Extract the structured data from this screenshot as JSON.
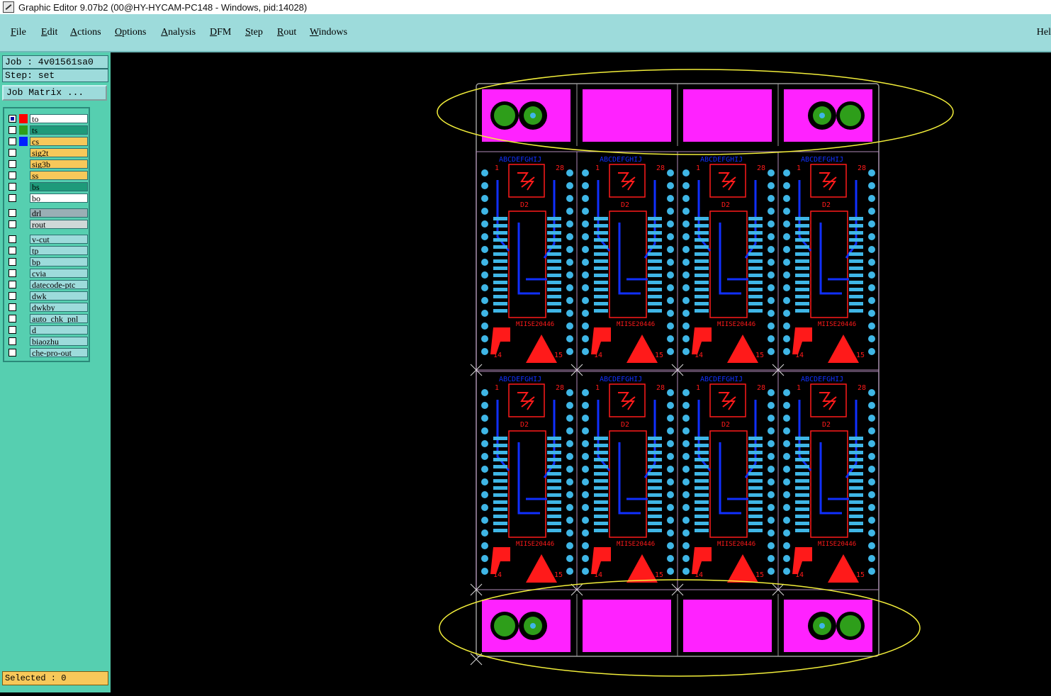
{
  "window": {
    "title": "Graphic Editor 9.07b2 (00@HY-HYCAM-PC148 - Windows, pid:14028)"
  },
  "menu": {
    "items": [
      "File",
      "Edit",
      "Actions",
      "Options",
      "Analysis",
      "DFM",
      "Step",
      "Rout",
      "Windows"
    ],
    "help": "Hel"
  },
  "job": {
    "label": "Job : 4v01561sa0",
    "step": "Step: set",
    "matrix_button": "Job Matrix ..."
  },
  "layers": [
    {
      "name": "to",
      "color": "#ff0000",
      "bg": "#ffffff",
      "selected": true
    },
    {
      "name": "ts",
      "color": "#2e9e1a",
      "bg": "#1e9a7a",
      "selected": false
    },
    {
      "name": "cs",
      "color": "#0020ff",
      "bg": "#f7c85a",
      "selected": false
    },
    {
      "name": "sig2t",
      "color": "",
      "bg": "#f7c85a",
      "selected": false
    },
    {
      "name": "sig3b",
      "color": "",
      "bg": "#f7c85a",
      "selected": false
    },
    {
      "name": "ss",
      "color": "",
      "bg": "#f7c85a",
      "selected": false
    },
    {
      "name": "bs",
      "color": "",
      "bg": "#1e9a7a",
      "selected": false
    },
    {
      "name": "bo",
      "color": "",
      "bg": "#ffffff",
      "selected": false
    },
    {
      "name": "drl",
      "color": "",
      "bg": "#9aafb5",
      "selected": false
    },
    {
      "name": "rout",
      "color": "",
      "bg": "#cfd8d8",
      "selected": false
    },
    {
      "name": "v-cut",
      "color": "",
      "bg": "#9ddbdb",
      "selected": false
    },
    {
      "name": "tp",
      "color": "",
      "bg": "#9ddbdb",
      "selected": false
    },
    {
      "name": "bp",
      "color": "",
      "bg": "#9ddbdb",
      "selected": false
    },
    {
      "name": "cvia",
      "color": "",
      "bg": "#9ddbdb",
      "selected": false
    },
    {
      "name": "datecode-ptc",
      "color": "",
      "bg": "#9ddbdb",
      "selected": false
    },
    {
      "name": "dwk",
      "color": "",
      "bg": "#9ddbdb",
      "selected": false
    },
    {
      "name": "dwkby",
      "color": "",
      "bg": "#9ddbdb",
      "selected": false
    },
    {
      "name": "auto_chk_pnl",
      "color": "",
      "bg": "#9ddbdb",
      "selected": false
    },
    {
      "name": "d",
      "color": "",
      "bg": "#9ddbdb",
      "selected": false
    },
    {
      "name": "biaozhu",
      "color": "",
      "bg": "#9ddbdb",
      "selected": false
    },
    {
      "name": "che-pro-out",
      "color": "",
      "bg": "#9ddbdb",
      "selected": false
    }
  ],
  "status": {
    "selected": "Selected : 0"
  },
  "board": {
    "unit_text": "ABCDEFGHIJ",
    "pin_first": "1",
    "pin_last": "28",
    "ref": "D2",
    "part_code": "MIISE20446",
    "pin_bottom_left": "14",
    "pin_bottom_right": "15",
    "colors": {
      "pad": "#ff22ff",
      "trace": "#1030ff",
      "silk": "#ff1a1a",
      "smd": "#3fb6e6",
      "fiducial": "#2e9e1a",
      "highlight": "#f2ee3a",
      "outline": "#9a9a9a"
    }
  }
}
